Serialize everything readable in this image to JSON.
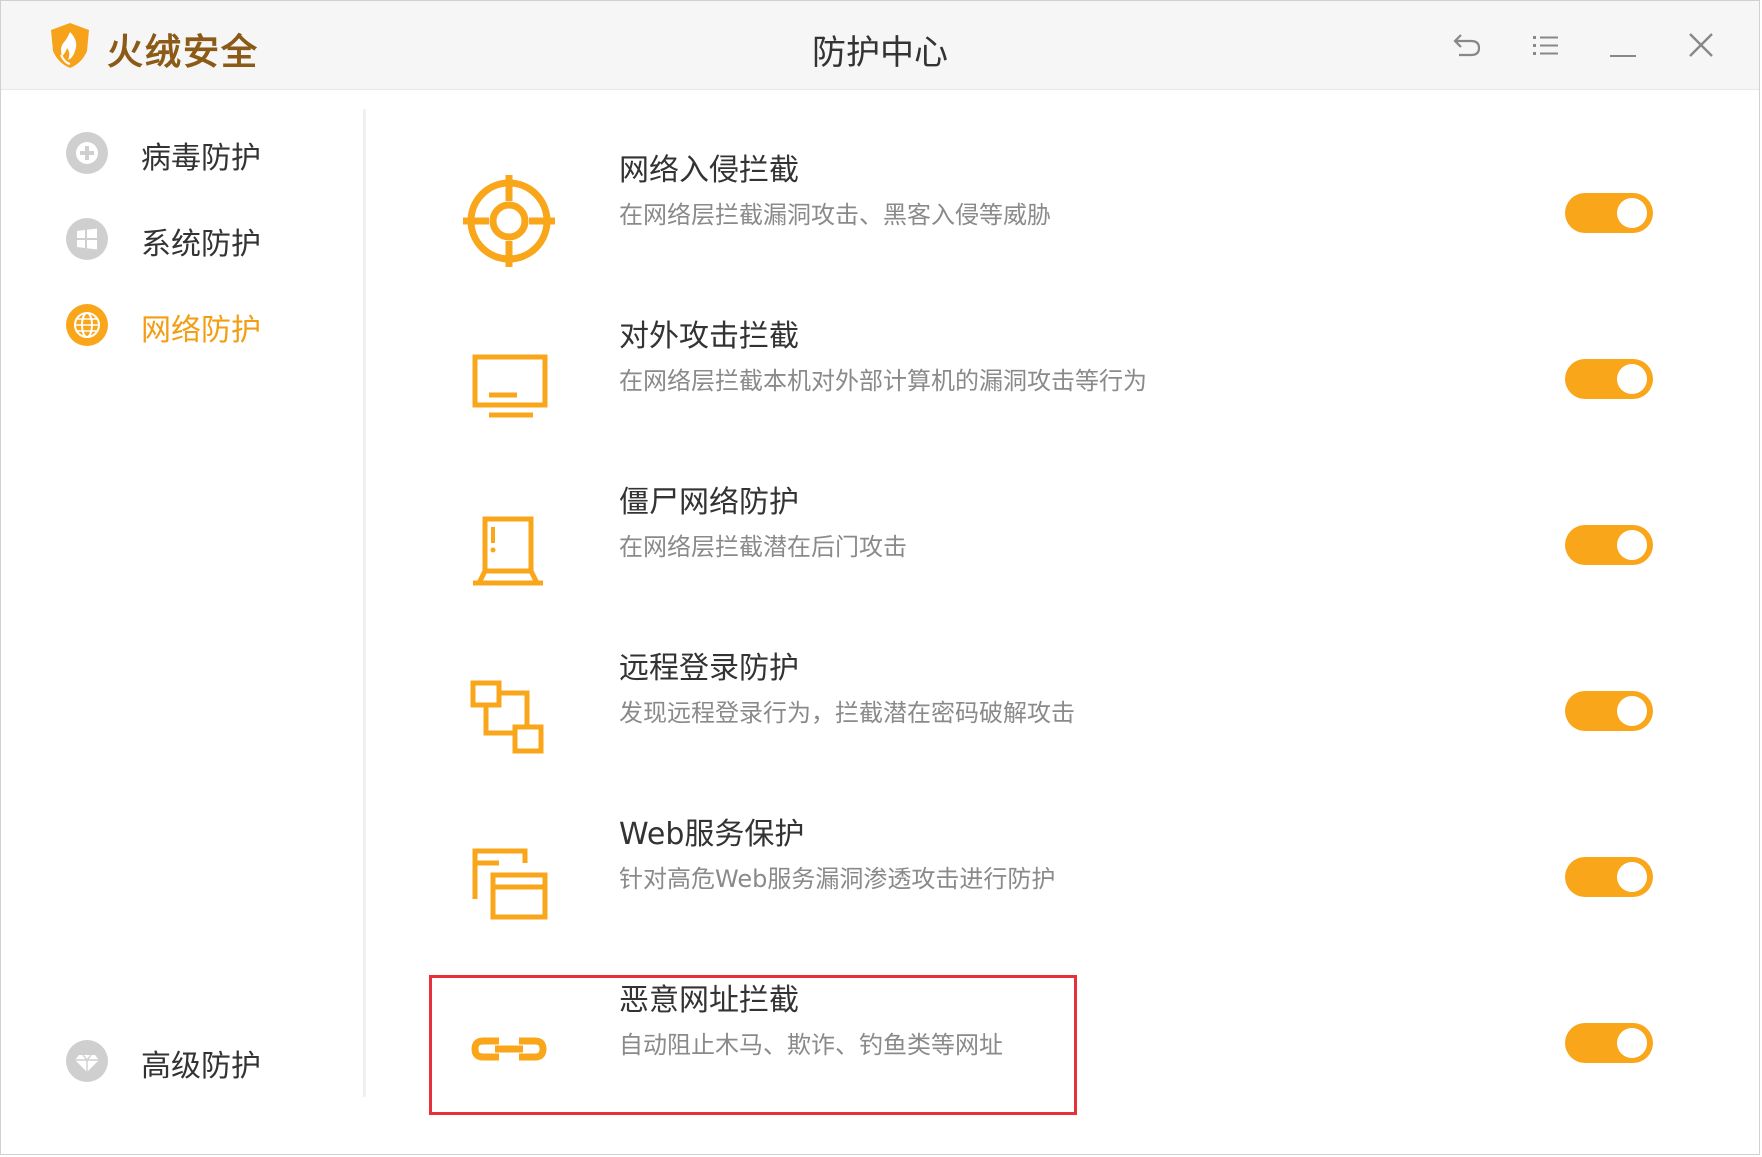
{
  "app": {
    "brand": "火绒安全",
    "window_title": "防护中心"
  },
  "colors": {
    "accent": "#f9a61a",
    "brand": "#8a5a16",
    "highlight": "#e8303a",
    "inactive_icon": "#c8c8c8"
  },
  "titlebar": {
    "buttons": [
      {
        "name": "back-icon"
      },
      {
        "name": "menu-icon"
      },
      {
        "name": "minimize-icon"
      },
      {
        "name": "close-icon"
      }
    ]
  },
  "sidebar": {
    "items": [
      {
        "label": "病毒防护",
        "icon": "plus-circle-icon",
        "active": false
      },
      {
        "label": "系统防护",
        "icon": "windows-icon",
        "active": false
      },
      {
        "label": "网络防护",
        "icon": "globe-icon",
        "active": true
      }
    ],
    "bottom_item": {
      "label": "高级防护",
      "icon": "diamond-icon"
    }
  },
  "protections": [
    {
      "title": "网络入侵拦截",
      "desc": "在网络层拦截漏洞攻击、黑客入侵等威胁",
      "icon": "crosshair-icon",
      "enabled": true
    },
    {
      "title": "对外攻击拦截",
      "desc": "在网络层拦截本机对外部计算机的漏洞攻击等行为",
      "icon": "monitor-icon",
      "enabled": true
    },
    {
      "title": "僵尸网络防护",
      "desc": "在网络层拦截潜在后门攻击",
      "icon": "laptop-alert-icon",
      "enabled": true
    },
    {
      "title": "远程登录防护",
      "desc": "发现远程登录行为，拦截潜在密码破解攻击",
      "icon": "remote-link-icon",
      "enabled": true
    },
    {
      "title": "Web服务保护",
      "desc": "针对高危Web服务漏洞渗透攻击进行防护",
      "icon": "web-windows-icon",
      "enabled": true
    },
    {
      "title": "恶意网址拦截",
      "desc": "自动阻止木马、欺诈、钓鱼类等网址",
      "icon": "link-icon",
      "enabled": true
    }
  ]
}
